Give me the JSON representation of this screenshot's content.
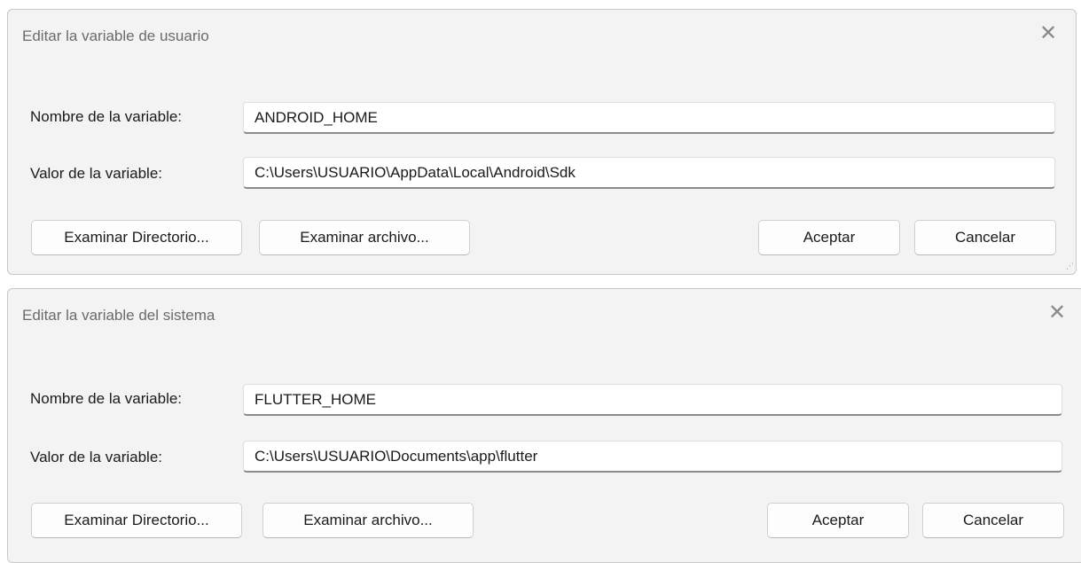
{
  "dialogs": [
    {
      "title": "Editar la variable de usuario",
      "name_label": "Nombre de la variable:",
      "name_value": "ANDROID_HOME",
      "value_label": "Valor de la variable:",
      "value_value": "C:\\Users\\USUARIO\\AppData\\Local\\Android\\Sdk",
      "browse_dir_label": "Examinar Directorio...",
      "browse_file_label": "Examinar archivo...",
      "accept_label": "Aceptar",
      "cancel_label": "Cancelar"
    },
    {
      "title": "Editar la variable del sistema",
      "name_label": "Nombre de la variable:",
      "name_value": "FLUTTER_HOME",
      "value_label": "Valor de la variable:",
      "value_value": "C:\\Users\\USUARIO\\Documents\\app\\flutter",
      "browse_dir_label": "Examinar Directorio...",
      "browse_file_label": "Examinar archivo...",
      "accept_label": "Aceptar",
      "cancel_label": "Cancelar"
    }
  ],
  "icons": {
    "close": "close-icon",
    "resize": "resize-grip-icon"
  },
  "colors": {
    "dialog_bg": "#f3f3f3",
    "field_bg": "#ffffff",
    "title_text": "#6b6b6b",
    "text": "#1a1a1a"
  }
}
